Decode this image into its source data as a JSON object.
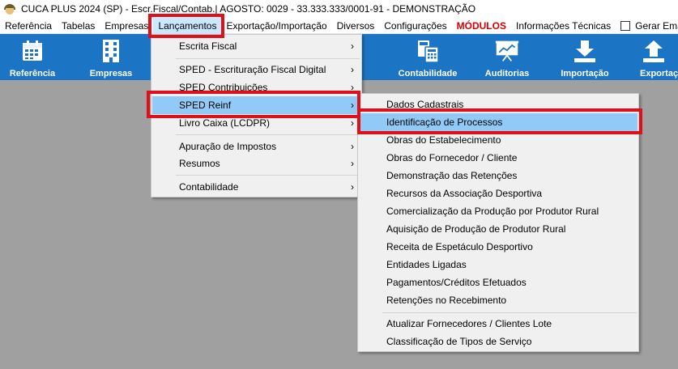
{
  "window": {
    "title": "CUCA PLUS 2024 (SP) - Escr.Fiscal/Contab.| AGOSTO: 0029 - 33.333.333/0001-91 - DEMONSTRAÇÃO",
    "icon": "app-logo-icon"
  },
  "menubar": {
    "items": [
      {
        "label": "Referência"
      },
      {
        "label": "Tabelas"
      },
      {
        "label": "Empresas"
      },
      {
        "label": "Lançamentos"
      },
      {
        "label": "Exportação/Importação"
      },
      {
        "label": "Diversos"
      },
      {
        "label": "Configurações"
      },
      {
        "label": "MÓDULOS"
      },
      {
        "label": "Informações Técnicas"
      }
    ],
    "gerar_email_label": "Gerar Email",
    "active_color": "#cce8ff",
    "modules_color": "#d90000"
  },
  "toolbar": {
    "background": "#1c75c4",
    "buttons": [
      {
        "label": "Referência",
        "icon": "calendar-icon"
      },
      {
        "label": "Empresas",
        "icon": "building-icon"
      },
      {
        "label": "Contabilidade",
        "icon": "calculator-icon"
      },
      {
        "label": "Auditorias",
        "icon": "presentation-chart-icon"
      },
      {
        "label": "Importação",
        "icon": "download-icon"
      },
      {
        "label": "Exportação",
        "icon": "upload-icon"
      }
    ]
  },
  "lancamentos_menu": {
    "items": [
      {
        "label": "Escrita Fiscal",
        "has_submenu": true
      },
      {
        "label": "SPED - Escrituração Fiscal Digital",
        "has_submenu": true
      },
      {
        "label": "SPED Contribuições",
        "has_submenu": true
      },
      {
        "label": "SPED Reinf",
        "has_submenu": true
      },
      {
        "label": "Livro Caixa (LCDPR)",
        "has_submenu": true
      },
      {
        "label": "Apuração de Impostos",
        "has_submenu": true
      },
      {
        "label": "Resumos",
        "has_submenu": true
      },
      {
        "label": "Contabilidade",
        "has_submenu": true
      }
    ],
    "arrow": "›"
  },
  "reinf_submenu": {
    "items": [
      {
        "label": "Dados Cadastrais"
      },
      {
        "label": "Identificação de Processos"
      },
      {
        "label": "Obras do Estabelecimento"
      },
      {
        "label": "Obras do Fornecedor / Cliente"
      },
      {
        "label": "Demonstração das Retenções"
      },
      {
        "label": "Recursos da Associação Desportiva"
      },
      {
        "label": "Comercialização da Produção por Produtor Rural"
      },
      {
        "label": "Aquisição de Produção de Produtor Rural"
      },
      {
        "label": "Receita de Espetáculo Desportivo"
      },
      {
        "label": "Entidades Ligadas"
      },
      {
        "label": "Pagamentos/Créditos Efetuados"
      },
      {
        "label": "Retenções no Recebimento"
      },
      {
        "label": "Atualizar Fornecedores / Clientes Lote"
      },
      {
        "label": "Classificação de Tipos de Serviço"
      }
    ],
    "highlight_color": "#91c9f7"
  },
  "annotation_color": "#e0101a"
}
